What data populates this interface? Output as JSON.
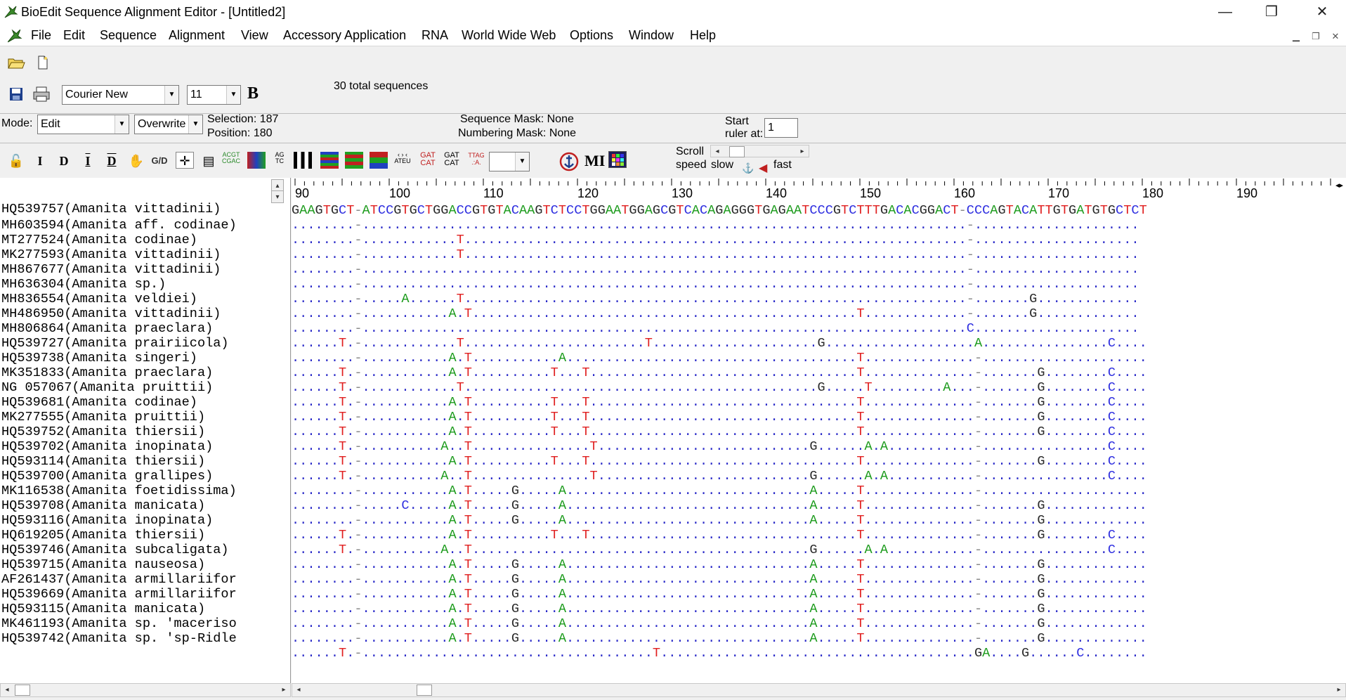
{
  "window": {
    "title": "BioEdit Sequence Alignment Editor - [Untitled2]",
    "min_glyph": "—",
    "max_glyph": "❐",
    "close_glyph": "✕"
  },
  "menu": [
    "File",
    "Edit",
    "Sequence",
    "Alignment",
    "View",
    "Accessory Application",
    "RNA",
    "World Wide Web",
    "Options",
    "Window",
    "Help"
  ],
  "toolbar": {
    "font_name": "Courier New",
    "font_size": "11",
    "bold_label": "B",
    "total_sequences": "30 total sequences",
    "mode_label": "Mode:",
    "mode_value": "Edit",
    "overwrite_value": "Overwrite",
    "selection_label": "Selection: 187",
    "position_label": "Position:   180",
    "sequence_mask": "Sequence Mask: None",
    "numbering_mask": "Numbering Mask: None",
    "start_label": "Start",
    "ruler_at_label": "ruler at:",
    "ruler_start": "1",
    "scroll_label": "Scroll",
    "speed_label": "speed",
    "slow_label": "slow",
    "fast_label": "fast",
    "mi_label": "MI"
  },
  "ruler": [
    "90",
    "100",
    "110",
    "120",
    "130",
    "140",
    "150",
    "160",
    "170",
    "180",
    "190"
  ],
  "alignment": {
    "consensus": "GAAGTGCT-ATCCGTGCTGGACCGTGTACAAGTCTCCTGGAATGGAGCGTCACAGAGGGTGAGAATCCCGTCTTTGACACGGACT-CCCAGTACATTGTGATGTGCTCT",
    "names": [
      "HQ539757(Amanita vittadinii)",
      "MH603594(Amanita aff. codinae)",
      "MT277524(Amanita codinae)",
      "MK277593(Amanita vittadinii)",
      "MH867677(Amanita vittadinii)",
      "MH636304(Amanita sp.)",
      "MH836554(Amanita veldiei)",
      "MH486950(Amanita vittadinii)",
      "MH806864(Amanita praeclara)",
      "HQ539727(Amanita prairiicola)",
      "HQ539738(Amanita singeri)",
      "MK351833(Amanita praeclara)",
      "NG 057067(Amanita pruittii)",
      "HQ539681(Amanita codinae)",
      "MK277555(Amanita pruittii)",
      "HQ539752(Amanita thiersii)",
      "HQ539702(Amanita inopinata)",
      "HQ593114(Amanita thiersii)",
      "HQ539700(Amanita grallipes)",
      "MK116538(Amanita foetidissima)",
      "HQ539708(Amanita manicata)",
      "HQ593116(Amanita inopinata)",
      "HQ619205(Amanita thiersii)",
      "HQ539746(Amanita subcaligata)",
      "HQ539715(Amanita nauseosa)",
      "AF261437(Amanita armillariifor",
      "HQ539669(Amanita armillariifor",
      "HQ593115(Amanita manicata)",
      "MK461193(Amanita sp. 'maceriso",
      "HQ539742(Amanita sp. 'sp-Ridle"
    ],
    "rows": [
      "........-.............................................................................-.....................",
      "........-............T................................................................-.....................",
      "........-............T................................................................-.....................",
      "........-.............................................................................-.....................",
      "........-.............................................................................-.....................",
      "........-.....A......T................................................................-.......G.............",
      "........-...........A.T.................................................T.............-.......G.............",
      "........-.............................................................................C.....................",
      "......T.-............T.......................T.....................G...................A................C....",
      "........-...........A.T...........A.....................................T..............-.....................",
      "......T.-...........A.T..........T...T..................................T..............-.......G........C....",
      "......T.-............T.............................................G.....T.........A...-.......G........C....",
      "......T.-...........A.T..........T...T..................................T..............-.......G........C....",
      "......T.-...........A.T..........T...T..................................T..............-.......G........C....",
      "......T.-...........A.T..........T...T..................................T..............-.......G........C....",
      "......T.-..........A..T...............T...........................G......A.A...........-................C....",
      "......T.-...........A.T..........T...T..................................T..............-.......G........C....",
      "......T.-..........A..T...............T...........................G......A.A...........-................C....",
      "........-...........A.T.....G.....A...............................A.....T..............-.....................",
      "........-.....C.....A.T.....G.....A...............................A.....T..............-.......G.............",
      "........-...........A.T.....G.....A...............................A.....T..............-.......G.............",
      "......T.-...........A.T..........T...T..................................T..............-.......G........C....",
      "......T.-..........A..T...........................................G......A.A...........-................C....",
      "........-...........A.T.....G.....A...............................A.....T..............-.......G.............",
      "........-...........A.T.....G.....A...............................A.....T..............-.......G.............",
      "........-...........A.T.....G.....A...............................A.....T..............-.......G.............",
      "........-...........A.T.....G.....A...............................A.....T..............-.......G.............",
      "........-...........A.T.....G.....A...............................A.....T..............-.......G.............",
      "........-...........A.T.....G.....A...............................A.....T..............-.......G.............",
      "......T.-.....................................T........................................GA....G......C........"
    ]
  }
}
